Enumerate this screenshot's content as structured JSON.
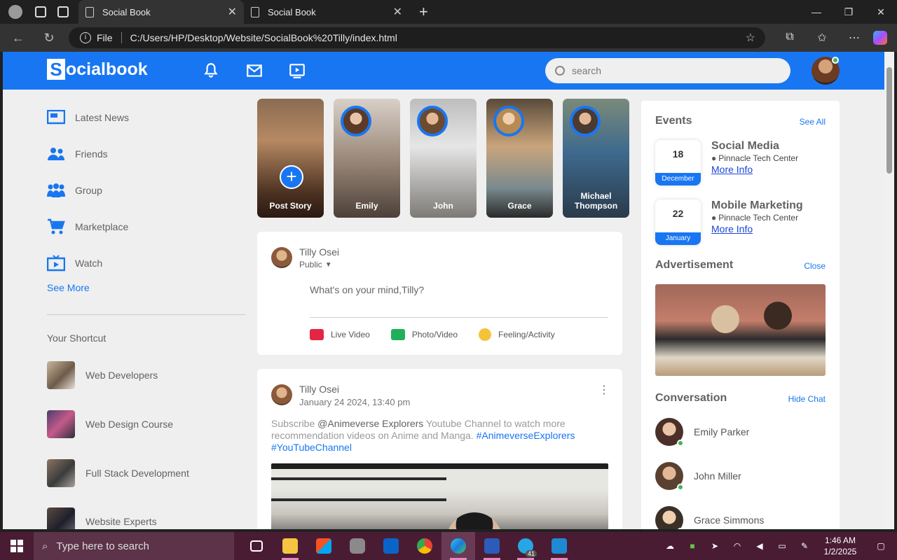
{
  "browser": {
    "tabs": [
      {
        "title": "Social Book",
        "active": true
      },
      {
        "title": "Social Book",
        "active": false
      }
    ],
    "url_prefix": "File",
    "url": "C:/Users/HP/Desktop/Website/SocialBook%20Tilly/index.html"
  },
  "header": {
    "logo_letter": "S",
    "logo_rest": "ocialbook",
    "search_placeholder": "search"
  },
  "sidebar": {
    "items": [
      {
        "label": "Latest News",
        "icon": "news-icon"
      },
      {
        "label": "Friends",
        "icon": "friends-icon"
      },
      {
        "label": "Group",
        "icon": "group-icon"
      },
      {
        "label": "Marketplace",
        "icon": "cart-icon"
      },
      {
        "label": "Watch",
        "icon": "watch-icon"
      }
    ],
    "see_more": "See More",
    "shortcut_title": "Your Shortcut",
    "shortcuts": [
      "Web Developers",
      "Web Design Course",
      "Full Stack Development",
      "Website Experts"
    ]
  },
  "stories": [
    {
      "name": "Post Story"
    },
    {
      "name": "Emily"
    },
    {
      "name": "John"
    },
    {
      "name": "Grace"
    },
    {
      "name": "Michael Thompson"
    }
  ],
  "composer": {
    "user": "Tilly Osei",
    "privacy": "Public",
    "placeholder": "What's on your mind,Tilly?",
    "actions": [
      "Live Video",
      "Photo/Video",
      "Feeling/Activity"
    ]
  },
  "post": {
    "user": "Tilly Osei",
    "time": "January 24 2024, 13:40 pm",
    "text_1": "Subscribe ",
    "mention": "@Animeverse Explorers",
    "text_2": " Youtube Channel to watch more recommendation videos on Anime and Manga. ",
    "tag_1": "#AnimeverseExplorers",
    "tag_2": "#YouTubeChannel"
  },
  "right": {
    "events_title": "Events",
    "see_all": "See All",
    "events": [
      {
        "day": "18",
        "month": "December",
        "title": "Social Media",
        "location": "Pinnacle Tech Center",
        "more": "More Info"
      },
      {
        "day": "22",
        "month": "January",
        "title": "Mobile Marketing",
        "location": "Pinnacle Tech Center",
        "more": "More Info"
      }
    ],
    "ad_title": "Advertisement",
    "ad_close": "Close",
    "conv_title": "Conversation",
    "hide_chat": "Hide Chat",
    "contacts": [
      "Emily Parker",
      "John Miller",
      "Grace Simmons"
    ]
  },
  "taskbar": {
    "search_placeholder": "Type here to search",
    "time": "1:46 AM",
    "date": "1/2/2025",
    "telegram_badge": "41"
  },
  "colors": {
    "brand": "#1876f2",
    "online": "#41b35d"
  }
}
